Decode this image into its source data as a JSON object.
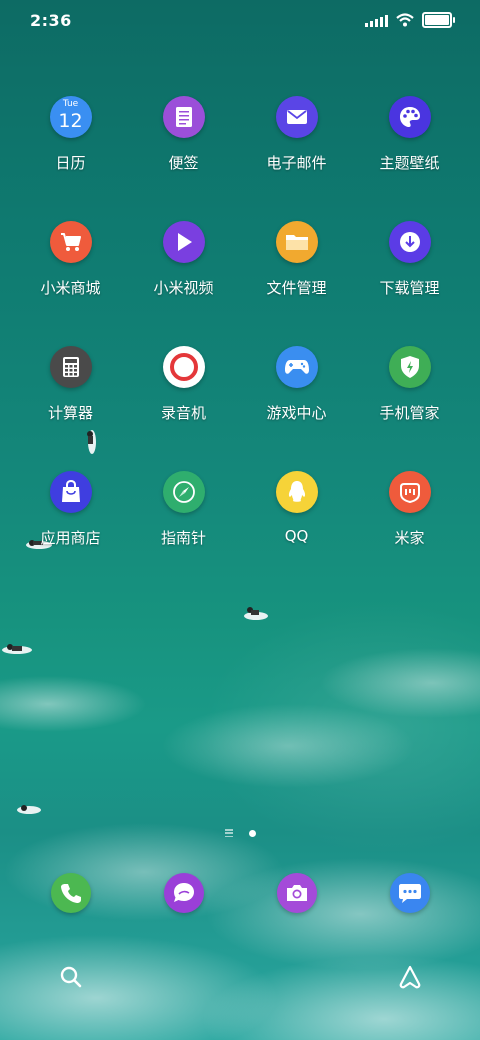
{
  "status_bar": {
    "time": "2:36"
  },
  "apps": [
    {
      "label": "日历",
      "icon": "calendar-icon",
      "color": "#3a8ff2",
      "cal_day": "Tue",
      "cal_date": "12"
    },
    {
      "label": "便签",
      "icon": "notes-icon",
      "color": "#9b4fd9"
    },
    {
      "label": "电子邮件",
      "icon": "mail-icon",
      "color": "#5a45e6"
    },
    {
      "label": "主题壁纸",
      "icon": "palette-icon",
      "color": "#4a35e0"
    },
    {
      "label": "小米商城",
      "icon": "cart-icon",
      "color": "#ef5b3c"
    },
    {
      "label": "小米视频",
      "icon": "play-icon",
      "color": "#7a3fe0"
    },
    {
      "label": "文件管理",
      "icon": "folder-icon",
      "color": "#f1a92f"
    },
    {
      "label": "下载管理",
      "icon": "download-icon",
      "color": "#5b3ce6"
    },
    {
      "label": "计算器",
      "icon": "calculator-icon",
      "color": "#4a4a4a"
    },
    {
      "label": "录音机",
      "icon": "recorder-icon",
      "color": "#ffffff"
    },
    {
      "label": "游戏中心",
      "icon": "gamepad-icon",
      "color": "#3a8ef0"
    },
    {
      "label": "手机管家",
      "icon": "shield-icon",
      "color": "#3fae56"
    },
    {
      "label": "应用商店",
      "icon": "shopping-bag-icon",
      "color": "#3f3ee0"
    },
    {
      "label": "指南针",
      "icon": "compass-icon",
      "color": "#2fae6e"
    },
    {
      "label": "QQ",
      "icon": "qq-penguin-icon",
      "color": "#f6d338"
    },
    {
      "label": "米家",
      "icon": "mijia-icon",
      "color": "#ef5b3c"
    }
  ],
  "dock": [
    {
      "icon": "phone-icon",
      "color": "#4cb851"
    },
    {
      "icon": "messages-icon",
      "color": "#9a3fd8"
    },
    {
      "icon": "camera-icon",
      "color": "#a44bd9"
    },
    {
      "icon": "chat-bubble-icon",
      "color": "#3a86f0"
    }
  ],
  "bottom_bar": {
    "search_icon": "search-icon",
    "assistant_icon": "assistant-icon"
  }
}
